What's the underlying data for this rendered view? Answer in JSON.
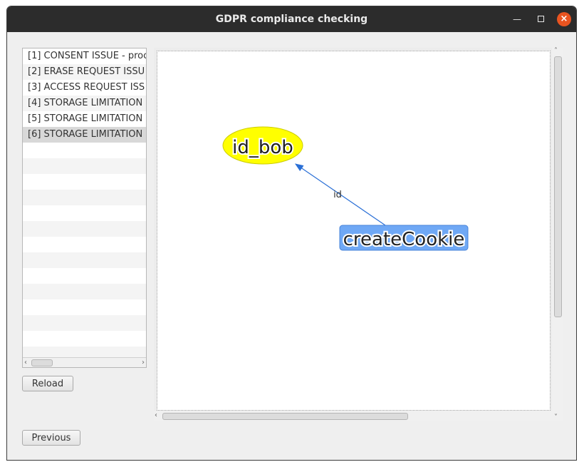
{
  "window": {
    "title": "GDPR compliance checking"
  },
  "titlebar_icons": [
    "minimize-icon",
    "maximize-icon",
    "close-icon"
  ],
  "issues": [
    {
      "label": "[1] CONSENT ISSUE - proc"
    },
    {
      "label": "[2] ERASE REQUEST ISSU"
    },
    {
      "label": "[3] ACCESS REQUEST ISS"
    },
    {
      "label": "[4] STORAGE LIMITATION"
    },
    {
      "label": "[5] STORAGE LIMITATION"
    },
    {
      "label": "[6] STORAGE LIMITATION",
      "selected": true
    }
  ],
  "buttons": {
    "reload": "Reload",
    "previous": "Previous"
  },
  "graph": {
    "nodes": [
      {
        "id": "id_bob",
        "label": "id_bob",
        "shape": "ellipse",
        "fill": "#ffff00",
        "stroke": "#cccc00"
      },
      {
        "id": "createCookie",
        "label": "createCookie",
        "shape": "rect",
        "fill": "#6fa8f5",
        "stroke": "#4a84d9"
      }
    ],
    "edges": [
      {
        "from": "createCookie",
        "to": "id_bob",
        "label": "id",
        "color": "#2a6fd6"
      }
    ]
  },
  "colors": {
    "titlebar": "#2c2c2c",
    "close_button": "#e95420",
    "selection": "#d8d8d8"
  }
}
